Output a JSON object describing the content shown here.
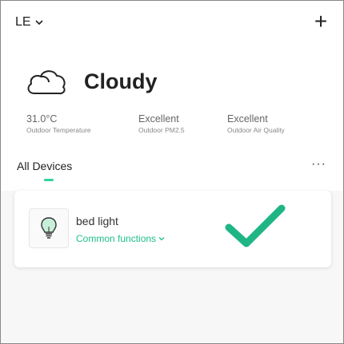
{
  "header": {
    "home_name": "LE",
    "add_label": "+"
  },
  "weather": {
    "condition": "Cloudy",
    "icon": "cloud-icon"
  },
  "stats": [
    {
      "value": "31.0°C",
      "label": "Outdoor Temperature"
    },
    {
      "value": "Excellent",
      "label": "Outdoor PM2.5"
    },
    {
      "value": "Excellent",
      "label": "Outdoor Air Quality"
    }
  ],
  "devices": {
    "tab_label": "All Devices",
    "more_label": "···",
    "items": [
      {
        "name": "bed light",
        "functions_label": "Common functions",
        "icon": "bulb-icon",
        "status_icon": "check-icon"
      }
    ]
  },
  "colors": {
    "accent": "#1fc08a",
    "check": "#1fb585",
    "tab_indicator": "#2fd3a0"
  }
}
